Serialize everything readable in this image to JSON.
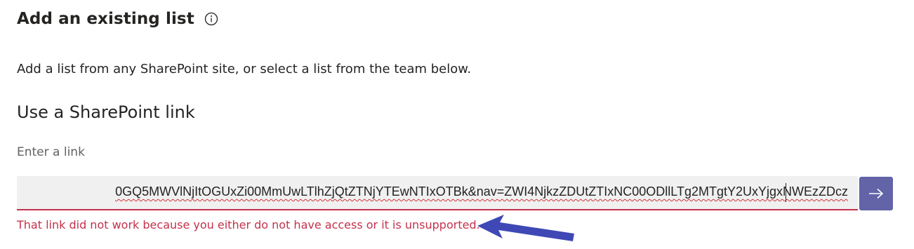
{
  "header": {
    "title": "Add an existing list",
    "info_icon": "info-icon"
  },
  "description": "Add a list from any SharePoint site, or select a list from the team below.",
  "sharepoint_link": {
    "section_title": "Use a SharePoint link",
    "field_label": "Enter a link",
    "input_value": "0GQ5MWVlNjItOGUxZi00MmUwLTlhZjQtZTNjYTEwNTIxOTBk&nav=ZWI4NjkzZDUtZTIxNC00ODllLTg2MTgtY2UxYjgxNWEzZDcz",
    "submit_icon": "arrow-right-icon",
    "error_message": "That link did not work because you either do not have access or it is unsupported."
  },
  "colors": {
    "accent": "#6264a7",
    "error": "#c4314b",
    "annotation_arrow": "#3f48b5"
  }
}
